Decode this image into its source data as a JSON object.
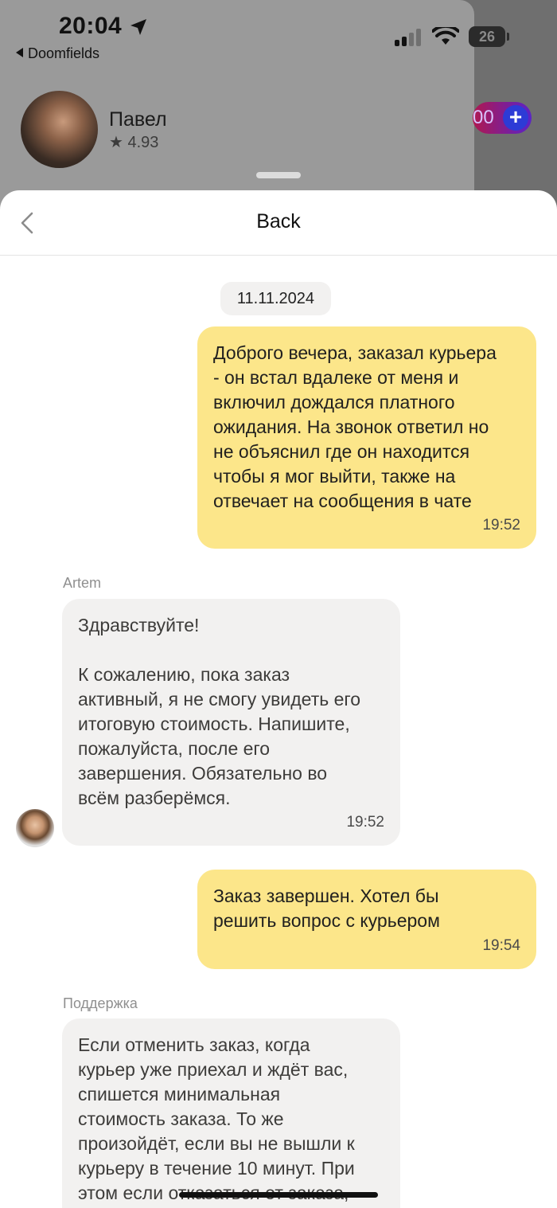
{
  "status_bar": {
    "time": "20:04",
    "back_app": "Doomfields",
    "battery": "26"
  },
  "background_app": {
    "driver_name": "Павел",
    "driver_rating": "★ 4.93",
    "pill_text": "00",
    "pill_icon": "+"
  },
  "chat": {
    "header_title": "Back",
    "date": "11.11.2024",
    "messages": [
      {
        "direction": "outgoing",
        "text": "Доброго вечера, заказал курьера\n- он встал вдалеке от меня и\nвключил дождался платного\nожидания. На звонок ответил но\nне объяснил где он находится\nчтобы я мог выйти, также на\nотвечает на сообщения в чате",
        "time": "19:52"
      },
      {
        "direction": "incoming",
        "sender": "Artem",
        "text": "Здравствуйте!\n\nК сожалению, пока заказ\nактивный, я не смогу увидеть его\nитоговую стоимость. Напишите,\nпожалуйста, после его\nзавершения. Обязательно во\nвсём разберёмся.",
        "time": "19:52"
      },
      {
        "direction": "outgoing",
        "text": "Заказ завершен. Хотел бы\nрешить вопрос с курьером",
        "time": "19:54"
      },
      {
        "direction": "incoming",
        "sender": "Поддержка",
        "text": "Если отменить заказ, когда\nкурьер уже приехал и ждёт вас,\nспишется минимальная\nстоимость заказа. То же\nпроизойдёт, если вы не вышли к\nкурьеру в течение 10 минут. При\nэтом если отказаться от заказа,",
        "time": ""
      }
    ]
  },
  "colors": {
    "outgoing_bubble": "#fce68a",
    "incoming_bubble": "#f2f1f0",
    "sheet_background": "#ffffff"
  }
}
